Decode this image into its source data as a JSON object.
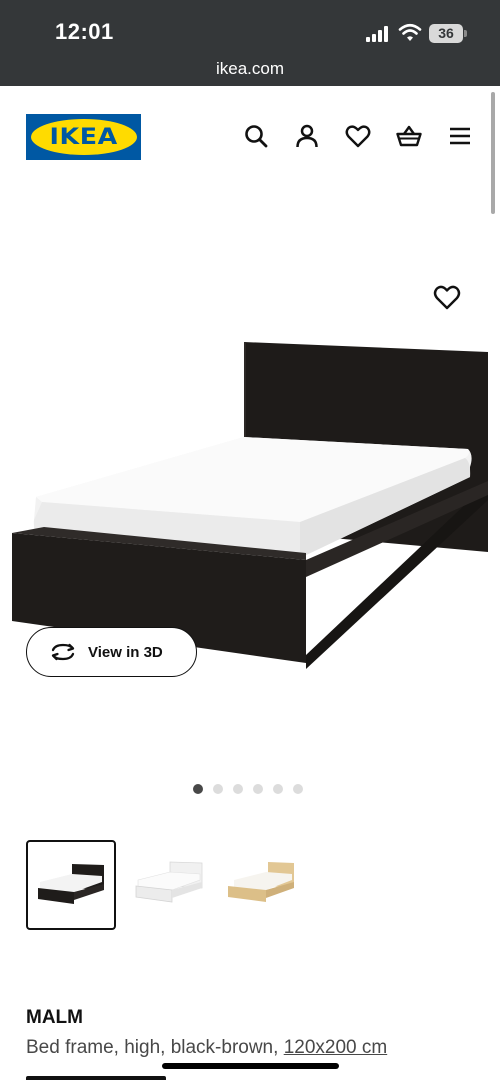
{
  "status_bar": {
    "time": "12:01",
    "battery": "36",
    "url": "ikea.com"
  },
  "header": {
    "logo_text": "IKEA",
    "icons": [
      "search-icon",
      "account-icon",
      "favourites-icon",
      "basket-icon",
      "menu-icon"
    ]
  },
  "gallery": {
    "view3d_label": "View in 3D",
    "slide_count": 6,
    "active_slide": 1,
    "thumbnails": [
      {
        "finish": "black-brown",
        "selected": true
      },
      {
        "finish": "white",
        "selected": false
      },
      {
        "finish": "oak veneer",
        "selected": false
      }
    ]
  },
  "product": {
    "name": "MALM",
    "description": "Bed frame, high, black-brown, ",
    "size_link": "120x200 cm"
  },
  "colors": {
    "ikea_blue": "#0058a3",
    "ikea_yellow": "#ffdb00",
    "status_bar": "#343739"
  }
}
